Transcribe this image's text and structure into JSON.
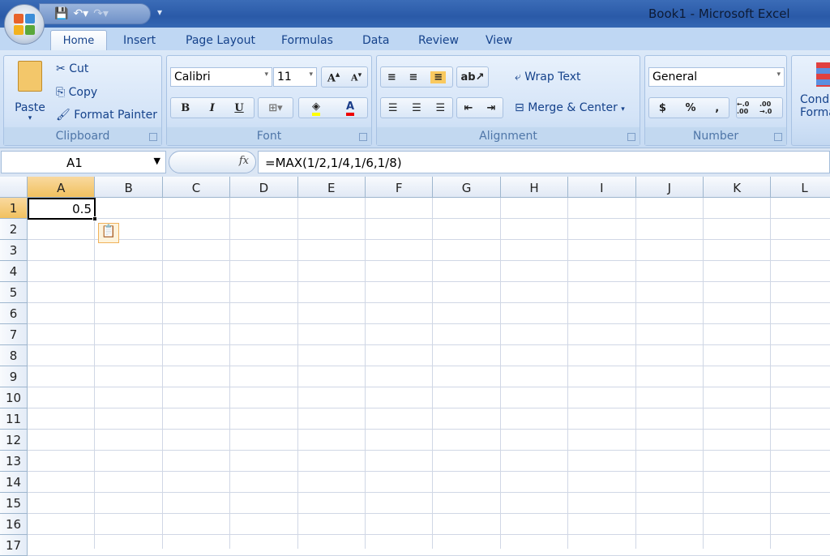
{
  "window": {
    "title": "Book1 - Microsoft Excel"
  },
  "tabs": [
    "Home",
    "Insert",
    "Page Layout",
    "Formulas",
    "Data",
    "Review",
    "View"
  ],
  "clipboard": {
    "paste": "Paste",
    "cut": "Cut",
    "copy": "Copy",
    "format_painter": "Format Painter",
    "label": "Clipboard"
  },
  "font": {
    "name": "Calibri",
    "size": "11",
    "label": "Font",
    "bold": "B",
    "italic": "I",
    "underline": "U"
  },
  "alignment": {
    "wrap": "Wrap Text",
    "merge": "Merge & Center",
    "label": "Alignment"
  },
  "number": {
    "format": "General",
    "label": "Number",
    "currency": "$",
    "percent": "%",
    "comma": ",",
    "inc": "←.0 .00",
    "dec": ".00 →.0"
  },
  "styles": {
    "cond": "Cond",
    "forma": "Forma"
  },
  "formula_bar": {
    "name_box": "A1",
    "fx": "fx",
    "formula": "=MAX(1/2,1/4,1/6,1/8)"
  },
  "sheet": {
    "columns": [
      "A",
      "B",
      "C",
      "D",
      "E",
      "F",
      "G",
      "H",
      "I",
      "J",
      "K",
      "L"
    ],
    "rows": [
      "1",
      "2",
      "3",
      "4",
      "5",
      "6",
      "7",
      "8",
      "9",
      "10",
      "11",
      "12",
      "13",
      "14",
      "15",
      "16",
      "17"
    ],
    "cells": {
      "A1": "0.5"
    }
  }
}
